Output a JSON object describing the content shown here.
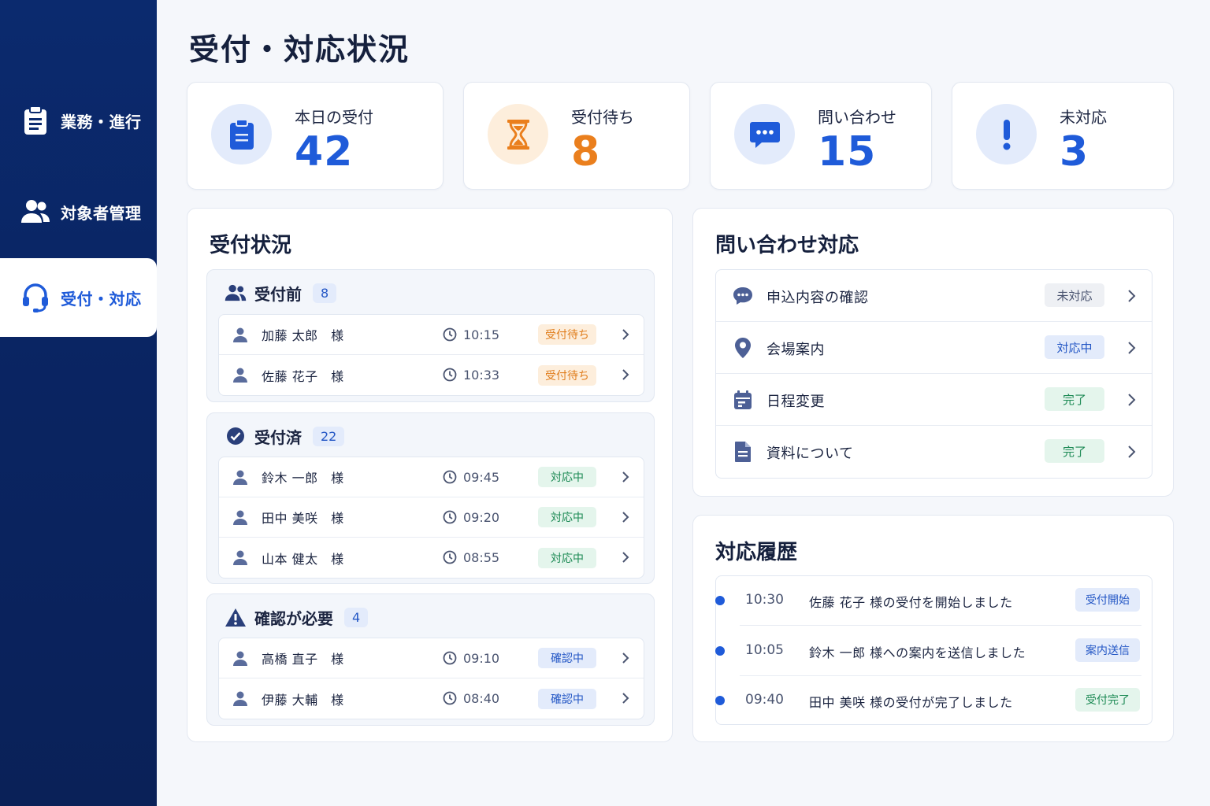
{
  "sidebar": {
    "items": [
      {
        "label": "業務・進行",
        "icon": "clipboard-icon",
        "active": false
      },
      {
        "label": "対象者管理",
        "icon": "users-icon",
        "active": false
      },
      {
        "label": "受付・対応",
        "icon": "headset-icon",
        "active": true
      }
    ]
  },
  "page": {
    "title": "受付・対応状況"
  },
  "stats": [
    {
      "label": "本日の受付",
      "value": "42",
      "icon": "clipboard-icon",
      "color": "#1f5bd9"
    },
    {
      "label": "受付待ち",
      "value": "8",
      "icon": "hourglass-icon",
      "color": "#ea7f1d"
    },
    {
      "label": "問い合わせ",
      "value": "15",
      "icon": "chat-icon",
      "color": "#1f5bd9"
    },
    {
      "label": "未対応",
      "value": "3",
      "icon": "exclamation-icon",
      "color": "#1f5bd9"
    }
  ],
  "reception": {
    "title": "受付状況",
    "groups": [
      {
        "title": "受付前",
        "count": "8",
        "icon": "users-icon",
        "rows": [
          {
            "name": "加藤 太郎　様",
            "time": "10:15",
            "status": "受付待ち"
          },
          {
            "name": "佐藤 花子　様",
            "time": "10:33",
            "status": "受付待ち"
          }
        ]
      },
      {
        "title": "受付済",
        "count": "22",
        "icon": "check-circle-icon",
        "rows": [
          {
            "name": "鈴木 一郎　様",
            "time": "09:45",
            "status": "対応中"
          },
          {
            "name": "田中 美咲　様",
            "time": "09:20",
            "status": "対応中"
          },
          {
            "name": "山本 健太　様",
            "time": "08:55",
            "status": "対応中"
          }
        ]
      },
      {
        "title": "確認が必要",
        "count": "4",
        "icon": "warning-icon",
        "rows": [
          {
            "name": "高橋 直子　様",
            "time": "09:10",
            "status": "確認中"
          },
          {
            "name": "伊藤 大輔　様",
            "time": "08:40",
            "status": "確認中"
          }
        ]
      }
    ]
  },
  "inquiries": {
    "title": "問い合わせ対応",
    "items": [
      {
        "label": "申込内容の確認",
        "status": "未対応",
        "icon": "chat-bubble-icon"
      },
      {
        "label": "会場案内",
        "status": "対応中",
        "icon": "location-pin-icon"
      },
      {
        "label": "日程変更",
        "status": "完了",
        "icon": "calendar-icon"
      },
      {
        "label": "資料について",
        "status": "完了",
        "icon": "document-icon"
      }
    ]
  },
  "history": {
    "title": "対応履歴",
    "items": [
      {
        "time": "10:30",
        "text": "佐藤 花子 様の受付を開始しました",
        "tag": "受付開始"
      },
      {
        "time": "10:05",
        "text": "鈴木 一郎 様への案内を送信しました",
        "tag": "案内送信"
      },
      {
        "time": "09:40",
        "text": "田中 美咲 様の受付が完了しました",
        "tag": "受付完了"
      }
    ]
  }
}
